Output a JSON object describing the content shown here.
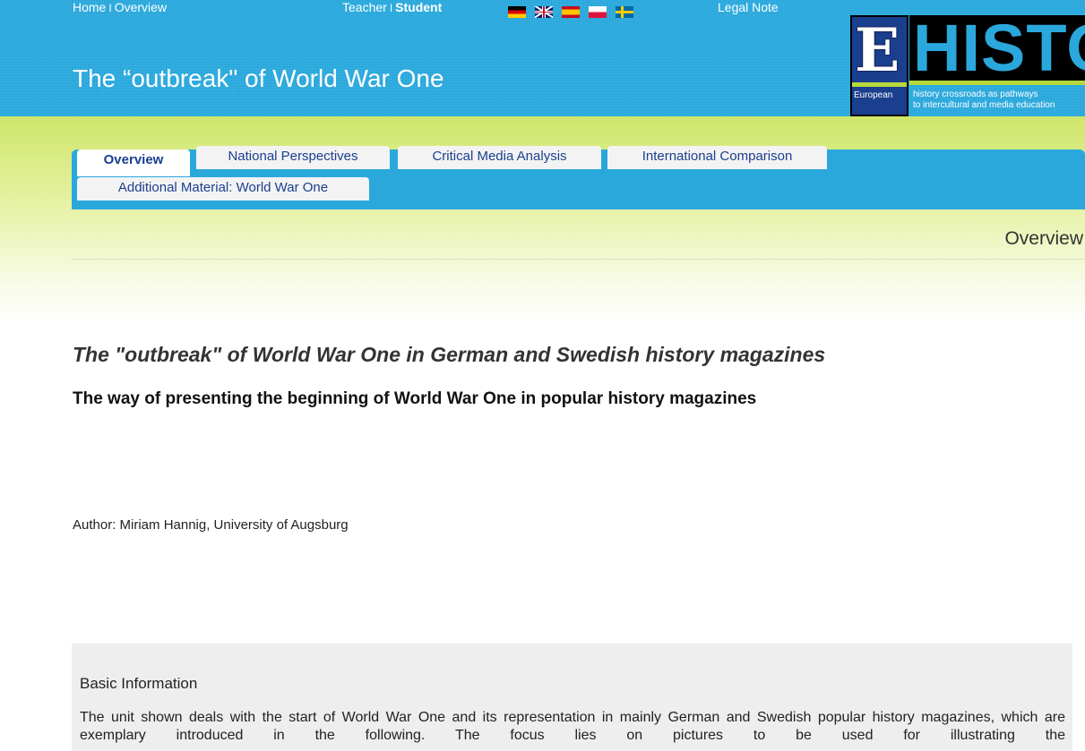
{
  "topnav": {
    "home": "Home",
    "overview": "Overview",
    "separator": "I",
    "teacher": "Teacher",
    "student": "Student",
    "legal_note": "Legal Note"
  },
  "flags": [
    {
      "name": "german-flag-icon",
      "color": "#dd0000"
    },
    {
      "name": "uk-flag-icon",
      "color": "#012169"
    },
    {
      "name": "spanish-flag-icon",
      "color": "#c60b1e"
    },
    {
      "name": "polish-flag-icon",
      "color": "#dc143c"
    },
    {
      "name": "swedish-flag-icon",
      "color": "#006aa7"
    }
  ],
  "header": {
    "title": "The “outbreak\" of World War One",
    "background_color": "#2aa8dc"
  },
  "logo": {
    "letter": "E",
    "word": "HISTO",
    "small_label": "European",
    "subtitle_line1": "history crossroads as pathways",
    "subtitle_line2": "to intercultural and media education"
  },
  "tabs": {
    "overview": "Overview",
    "national": "National Perspectives",
    "critical": "Critical Media Analysis",
    "international": "International Comparison",
    "additional": "Additional Material: World War One",
    "active": "Overview"
  },
  "section": {
    "heading": "Overview"
  },
  "content": {
    "subtitle": "The \"outbreak\" of World War One in German and Swedish history magazines",
    "tagline": "The way of presenting the beginning of World War One in popular history magazines",
    "author": "Author: Miriam Hannig, University of Augsburg"
  },
  "basic_info": {
    "title": "Basic Information",
    "text": "The unit shown deals with the start of World War One and its representation in mainly German and Swedish popular history magazines, which are exemplary introduced in the following. The focus lies on pictures to be used for illustrating the"
  }
}
